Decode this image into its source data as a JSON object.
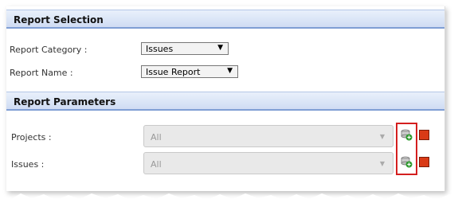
{
  "report_selection": {
    "header": "Report Selection",
    "category_label": "Report Category :",
    "category_value": "Issues",
    "name_label": "Report Name :",
    "name_value": "Issue Report"
  },
  "report_parameters": {
    "header": "Report Parameters",
    "projects_label": "Projects :",
    "projects_value": "All",
    "issues_label": "Issues :",
    "issues_value": "All"
  },
  "icons": {
    "add": "add-filter-icon",
    "remove": "remove-icon",
    "dropdown": "chevron-down-icon"
  },
  "colors": {
    "header_bg": "#cfdcf3",
    "highlight": "#d41f1f",
    "remove_icon": "#d93a16"
  }
}
